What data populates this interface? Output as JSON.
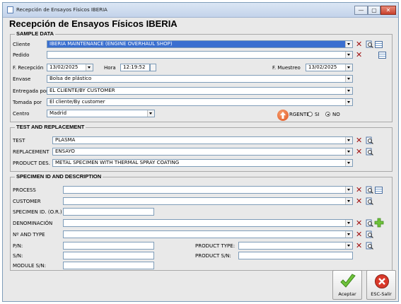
{
  "window": {
    "title": "Recepción de Ensayos Físicos IBERIA",
    "heading": "Recepción de Ensayos Físicos IBERIA",
    "controls": {
      "minimize": "—",
      "maximize": "▢",
      "close": "✕"
    }
  },
  "sample_data": {
    "title": "SAMPLE DATA",
    "cliente_label": "Cliente",
    "cliente_value": "IBERIA MAINTENANCE (ENGINE OVERHAUL SHOP)",
    "pedido_label": "Pedido",
    "pedido_value": "",
    "fecha_recepcion_label": "F. Recepción",
    "fecha_recepcion_value": "13/02/2025",
    "hora_label": "Hora",
    "hora_value": "12:19:52",
    "fecha_muestreo_label": "F. Muestreo",
    "fecha_muestreo_value": "13/02/2025",
    "envase_label": "Envase",
    "envase_value": "Bolsa de plástico",
    "entregada_label": "Entregada por",
    "entregada_value": "EL CLIENTE/BY CUSTOMER",
    "tomada_label": "Tomada por",
    "tomada_value": "El cliente/By customer",
    "centro_label": "Centro",
    "centro_value": "Madrid",
    "urgente_label": "RGENTE",
    "si_label": "SI",
    "no_label": "NO",
    "urgente_selected": "NO"
  },
  "test_replacement": {
    "title": "TEST AND REPLACEMENT",
    "test_label": "TEST",
    "test_value": "PLASMA",
    "replacement_label": "REPLACEMENT",
    "replacement_value": "ENSAYO",
    "product_label": "PRODUCT DES.",
    "product_value": "METAL SPECIMEN WITH THERMAL SPRAY COATING"
  },
  "specimen": {
    "title": "SPECIMEN ID AND DESCRIPTION",
    "process_label": "PROCESS",
    "customer_label": "CUSTOMER",
    "specimen_id_label": "SPECIMEN ID. (O.R.)",
    "denominacion_label": "DENOMINACIÓN",
    "n_and_type_label": "Nº AND TYPE",
    "pn_label": "P/N:",
    "sn_label": "S/N:",
    "module_sn_label": "MODULE S/N:",
    "product_type_label": "PRODUCT TYPE:",
    "product_sn_label": "PRODUCT S/N:"
  },
  "actions": {
    "aceptar_label": "Aceptar",
    "salir_label": "ESC-Salir"
  }
}
